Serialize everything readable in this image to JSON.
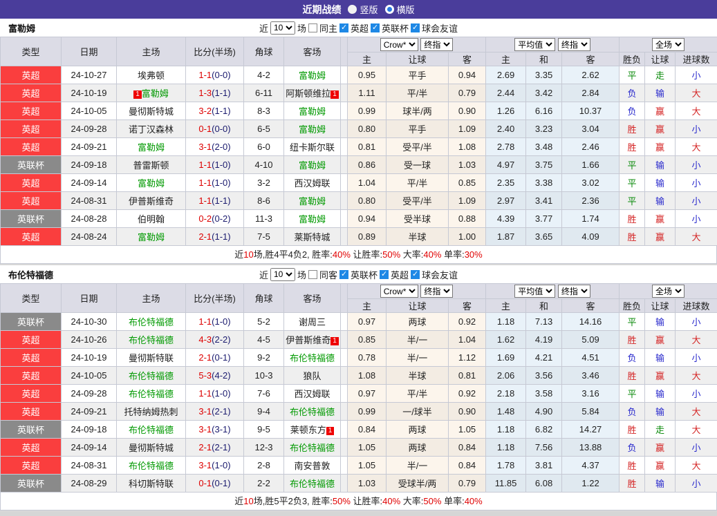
{
  "colors": {
    "titlebar_bg": "#4a3d9b",
    "epl_red": "#fa3e3e",
    "cup_gray": "#8a8a8a",
    "team_green": "#009900",
    "score_red": "#dd0000",
    "half_navy": "#1a1a6e",
    "win_red": "#d42424",
    "draw_green": "#0a8a0a",
    "lose_blue": "#2828cc",
    "avg_col_bg": "#e9f2f9",
    "handicap_col_bg": "#fcf5ec",
    "header_bg": "#dcdce6"
  },
  "title_bar": {
    "title": "近期战绩",
    "radios": [
      {
        "label": "竖版",
        "selected": false
      },
      {
        "label": "横版",
        "selected": true
      }
    ]
  },
  "sections": [
    {
      "team": "富勒姆",
      "filter": {
        "near_label": "近",
        "count": "10",
        "games_label": "场",
        "checkboxes": [
          {
            "label": "同主",
            "checked": false
          },
          {
            "label": "英超",
            "checked": true
          },
          {
            "label": "英联杯",
            "checked": true
          },
          {
            "label": "球会友谊",
            "checked": true
          }
        ]
      },
      "header": {
        "type": "类型",
        "date": "日期",
        "home": "主场",
        "score": "比分(半场)",
        "corners": "角球",
        "away": "客场",
        "odds_source": "Crow*",
        "odds_mode": "终指",
        "avg_source": "平均值",
        "avg_mode": "终指",
        "scope": "全场",
        "sub": [
          "主",
          "让球",
          "客",
          "主",
          "和",
          "客",
          "胜负",
          "让球",
          "进球数"
        ]
      },
      "rows": [
        {
          "league": "英超",
          "cup": false,
          "date": "24-10-27",
          "home": "埃弗顿",
          "homeGreen": false,
          "homeBadge": "",
          "score": "1-1",
          "half": "(0-0)",
          "corners": "4-2",
          "away": "富勒姆",
          "awayGreen": true,
          "awayBadge": "",
          "oddsHome": "0.95",
          "line": "平手",
          "oddsAway": "0.94",
          "avgHome": "2.69",
          "avgDraw": "3.35",
          "avgAway": "2.62",
          "res": "平",
          "hRes": "走",
          "gRes": "小"
        },
        {
          "league": "英超",
          "cup": false,
          "date": "24-10-19",
          "home": "富勒姆",
          "homeGreen": true,
          "homeBadge": "1",
          "score": "1-3",
          "half": "(1-1)",
          "corners": "6-11",
          "away": "阿斯顿维拉",
          "awayGreen": false,
          "awayBadge": "1",
          "oddsHome": "1.11",
          "line": "平/半",
          "oddsAway": "0.79",
          "avgHome": "2.44",
          "avgDraw": "3.42",
          "avgAway": "2.84",
          "res": "负",
          "hRes": "输",
          "gRes": "大"
        },
        {
          "league": "英超",
          "cup": false,
          "date": "24-10-05",
          "home": "曼彻斯特城",
          "homeGreen": false,
          "homeBadge": "",
          "score": "3-2",
          "half": "(1-1)",
          "corners": "8-3",
          "away": "富勒姆",
          "awayGreen": true,
          "awayBadge": "",
          "oddsHome": "0.99",
          "line": "球半/两",
          "oddsAway": "0.90",
          "avgHome": "1.26",
          "avgDraw": "6.16",
          "avgAway": "10.37",
          "res": "负",
          "hRes": "赢",
          "gRes": "大"
        },
        {
          "league": "英超",
          "cup": false,
          "date": "24-09-28",
          "home": "诺丁汉森林",
          "homeGreen": false,
          "homeBadge": "",
          "score": "0-1",
          "half": "(0-0)",
          "corners": "6-5",
          "away": "富勒姆",
          "awayGreen": true,
          "awayBadge": "",
          "oddsHome": "0.80",
          "line": "平手",
          "oddsAway": "1.09",
          "avgHome": "2.40",
          "avgDraw": "3.23",
          "avgAway": "3.04",
          "res": "胜",
          "hRes": "赢",
          "gRes": "小"
        },
        {
          "league": "英超",
          "cup": false,
          "date": "24-09-21",
          "home": "富勒姆",
          "homeGreen": true,
          "homeBadge": "",
          "score": "3-1",
          "half": "(2-0)",
          "corners": "6-0",
          "away": "纽卡斯尔联",
          "awayGreen": false,
          "awayBadge": "",
          "oddsHome": "0.81",
          "line": "受平/半",
          "oddsAway": "1.08",
          "avgHome": "2.78",
          "avgDraw": "3.48",
          "avgAway": "2.46",
          "res": "胜",
          "hRes": "赢",
          "gRes": "大"
        },
        {
          "league": "英联杯",
          "cup": true,
          "date": "24-09-18",
          "home": "普雷斯顿",
          "homeGreen": false,
          "homeBadge": "",
          "score": "1-1",
          "half": "(1-0)",
          "corners": "4-10",
          "away": "富勒姆",
          "awayGreen": true,
          "awayBadge": "",
          "oddsHome": "0.86",
          "line": "受一球",
          "oddsAway": "1.03",
          "avgHome": "4.97",
          "avgDraw": "3.75",
          "avgAway": "1.66",
          "res": "平",
          "hRes": "输",
          "gRes": "小"
        },
        {
          "league": "英超",
          "cup": false,
          "date": "24-09-14",
          "home": "富勒姆",
          "homeGreen": true,
          "homeBadge": "",
          "score": "1-1",
          "half": "(1-0)",
          "corners": "3-2",
          "away": "西汉姆联",
          "awayGreen": false,
          "awayBadge": "",
          "oddsHome": "1.04",
          "line": "平/半",
          "oddsAway": "0.85",
          "avgHome": "2.35",
          "avgDraw": "3.38",
          "avgAway": "3.02",
          "res": "平",
          "hRes": "输",
          "gRes": "小"
        },
        {
          "league": "英超",
          "cup": false,
          "date": "24-08-31",
          "home": "伊普斯维奇",
          "homeGreen": false,
          "homeBadge": "",
          "score": "1-1",
          "half": "(1-1)",
          "corners": "8-6",
          "away": "富勒姆",
          "awayGreen": true,
          "awayBadge": "",
          "oddsHome": "0.80",
          "line": "受平/半",
          "oddsAway": "1.09",
          "avgHome": "2.97",
          "avgDraw": "3.41",
          "avgAway": "2.36",
          "res": "平",
          "hRes": "输",
          "gRes": "小"
        },
        {
          "league": "英联杯",
          "cup": true,
          "date": "24-08-28",
          "home": "伯明翰",
          "homeGreen": false,
          "homeBadge": "",
          "score": "0-2",
          "half": "(0-2)",
          "corners": "11-3",
          "away": "富勒姆",
          "awayGreen": true,
          "awayBadge": "",
          "oddsHome": "0.94",
          "line": "受半球",
          "oddsAway": "0.88",
          "avgHome": "4.39",
          "avgDraw": "3.77",
          "avgAway": "1.74",
          "res": "胜",
          "hRes": "赢",
          "gRes": "小"
        },
        {
          "league": "英超",
          "cup": false,
          "date": "24-08-24",
          "home": "富勒姆",
          "homeGreen": true,
          "homeBadge": "",
          "score": "2-1",
          "half": "(1-1)",
          "corners": "7-5",
          "away": "莱斯特城",
          "awayGreen": false,
          "awayBadge": "",
          "oddsHome": "0.89",
          "line": "半球",
          "oddsAway": "1.00",
          "avgHome": "1.87",
          "avgDraw": "3.65",
          "avgAway": "4.09",
          "res": "胜",
          "hRes": "赢",
          "gRes": "大"
        }
      ],
      "summary": [
        {
          "t": "近",
          "r": false
        },
        {
          "t": "10",
          "r": true
        },
        {
          "t": "场,胜4平4负2, 胜率:",
          "r": false
        },
        {
          "t": "40%",
          "r": true
        },
        {
          "t": " 让胜率:",
          "r": false
        },
        {
          "t": "50%",
          "r": true
        },
        {
          "t": " 大率:",
          "r": false
        },
        {
          "t": "40%",
          "r": true
        },
        {
          "t": " 单率:",
          "r": false
        },
        {
          "t": "30%",
          "r": true
        }
      ]
    },
    {
      "team": "布伦特福德",
      "filter": {
        "near_label": "近",
        "count": "10",
        "games_label": "场",
        "checkboxes": [
          {
            "label": "同客",
            "checked": false
          },
          {
            "label": "英联杯",
            "checked": true
          },
          {
            "label": "英超",
            "checked": true
          },
          {
            "label": "球会友谊",
            "checked": true
          }
        ]
      },
      "header": {
        "type": "类型",
        "date": "日期",
        "home": "主场",
        "score": "比分(半场)",
        "corners": "角球",
        "away": "客场",
        "odds_source": "Crow*",
        "odds_mode": "终指",
        "avg_source": "平均值",
        "avg_mode": "终指",
        "scope": "全场",
        "sub": [
          "主",
          "让球",
          "客",
          "主",
          "和",
          "客",
          "胜负",
          "让球",
          "进球数"
        ]
      },
      "rows": [
        {
          "league": "英联杯",
          "cup": true,
          "date": "24-10-30",
          "home": "布伦特福德",
          "homeGreen": true,
          "homeBadge": "",
          "score": "1-1",
          "half": "(1-0)",
          "corners": "5-2",
          "away": "谢周三",
          "awayGreen": false,
          "awayBadge": "",
          "oddsHome": "0.97",
          "line": "两球",
          "oddsAway": "0.92",
          "avgHome": "1.18",
          "avgDraw": "7.13",
          "avgAway": "14.16",
          "res": "平",
          "hRes": "输",
          "gRes": "小"
        },
        {
          "league": "英超",
          "cup": false,
          "date": "24-10-26",
          "home": "布伦特福德",
          "homeGreen": true,
          "homeBadge": "",
          "score": "4-3",
          "half": "(2-2)",
          "corners": "4-5",
          "away": "伊普斯维奇",
          "awayGreen": false,
          "awayBadge": "1",
          "oddsHome": "0.85",
          "line": "半/一",
          "oddsAway": "1.04",
          "avgHome": "1.62",
          "avgDraw": "4.19",
          "avgAway": "5.09",
          "res": "胜",
          "hRes": "赢",
          "gRes": "大"
        },
        {
          "league": "英超",
          "cup": false,
          "date": "24-10-19",
          "home": "曼彻斯特联",
          "homeGreen": false,
          "homeBadge": "",
          "score": "2-1",
          "half": "(0-1)",
          "corners": "9-2",
          "away": "布伦特福德",
          "awayGreen": true,
          "awayBadge": "",
          "oddsHome": "0.78",
          "line": "半/一",
          "oddsAway": "1.12",
          "avgHome": "1.69",
          "avgDraw": "4.21",
          "avgAway": "4.51",
          "res": "负",
          "hRes": "输",
          "gRes": "小"
        },
        {
          "league": "英超",
          "cup": false,
          "date": "24-10-05",
          "home": "布伦特福德",
          "homeGreen": true,
          "homeBadge": "",
          "score": "5-3",
          "half": "(4-2)",
          "corners": "10-3",
          "away": "狼队",
          "awayGreen": false,
          "awayBadge": "",
          "oddsHome": "1.08",
          "line": "半球",
          "oddsAway": "0.81",
          "avgHome": "2.06",
          "avgDraw": "3.56",
          "avgAway": "3.46",
          "res": "胜",
          "hRes": "赢",
          "gRes": "大"
        },
        {
          "league": "英超",
          "cup": false,
          "date": "24-09-28",
          "home": "布伦特福德",
          "homeGreen": true,
          "homeBadge": "",
          "score": "1-1",
          "half": "(1-0)",
          "corners": "7-6",
          "away": "西汉姆联",
          "awayGreen": false,
          "awayBadge": "",
          "oddsHome": "0.97",
          "line": "平/半",
          "oddsAway": "0.92",
          "avgHome": "2.18",
          "avgDraw": "3.58",
          "avgAway": "3.16",
          "res": "平",
          "hRes": "输",
          "gRes": "小"
        },
        {
          "league": "英超",
          "cup": false,
          "date": "24-09-21",
          "home": "托特纳姆热刺",
          "homeGreen": false,
          "homeBadge": "",
          "score": "3-1",
          "half": "(2-1)",
          "corners": "9-4",
          "away": "布伦特福德",
          "awayGreen": true,
          "awayBadge": "",
          "oddsHome": "0.99",
          "line": "一/球半",
          "oddsAway": "0.90",
          "avgHome": "1.48",
          "avgDraw": "4.90",
          "avgAway": "5.84",
          "res": "负",
          "hRes": "输",
          "gRes": "大"
        },
        {
          "league": "英联杯",
          "cup": true,
          "date": "24-09-18",
          "home": "布伦特福德",
          "homeGreen": true,
          "homeBadge": "",
          "score": "3-1",
          "half": "(3-1)",
          "corners": "9-5",
          "away": "莱顿东方",
          "awayGreen": false,
          "awayBadge": "1",
          "oddsHome": "0.84",
          "line": "两球",
          "oddsAway": "1.05",
          "avgHome": "1.18",
          "avgDraw": "6.82",
          "avgAway": "14.27",
          "res": "胜",
          "hRes": "走",
          "gRes": "大"
        },
        {
          "league": "英超",
          "cup": false,
          "date": "24-09-14",
          "home": "曼彻斯特城",
          "homeGreen": false,
          "homeBadge": "",
          "score": "2-1",
          "half": "(2-1)",
          "corners": "12-3",
          "away": "布伦特福德",
          "awayGreen": true,
          "awayBadge": "",
          "oddsHome": "1.05",
          "line": "两球",
          "oddsAway": "0.84",
          "avgHome": "1.18",
          "avgDraw": "7.56",
          "avgAway": "13.88",
          "res": "负",
          "hRes": "赢",
          "gRes": "小"
        },
        {
          "league": "英超",
          "cup": false,
          "date": "24-08-31",
          "home": "布伦特福德",
          "homeGreen": true,
          "homeBadge": "",
          "score": "3-1",
          "half": "(1-0)",
          "corners": "2-8",
          "away": "南安普敦",
          "awayGreen": false,
          "awayBadge": "",
          "oddsHome": "1.05",
          "line": "半/一",
          "oddsAway": "0.84",
          "avgHome": "1.78",
          "avgDraw": "3.81",
          "avgAway": "4.37",
          "res": "胜",
          "hRes": "赢",
          "gRes": "大"
        },
        {
          "league": "英联杯",
          "cup": true,
          "date": "24-08-29",
          "home": "科切斯特联",
          "homeGreen": false,
          "homeBadge": "",
          "score": "0-1",
          "half": "(0-1)",
          "corners": "2-2",
          "away": "布伦特福德",
          "awayGreen": true,
          "awayBadge": "",
          "oddsHome": "1.03",
          "line": "受球半/两",
          "oddsAway": "0.79",
          "avgHome": "11.85",
          "avgDraw": "6.08",
          "avgAway": "1.22",
          "res": "胜",
          "hRes": "输",
          "gRes": "小"
        }
      ],
      "summary": [
        {
          "t": "近",
          "r": false
        },
        {
          "t": "10",
          "r": true
        },
        {
          "t": "场,胜5平2负3, 胜率:",
          "r": false
        },
        {
          "t": "50%",
          "r": true
        },
        {
          "t": " 让胜率:",
          "r": false
        },
        {
          "t": "40%",
          "r": true
        },
        {
          "t": " 大率:",
          "r": false
        },
        {
          "t": "50%",
          "r": true
        },
        {
          "t": " 单率:",
          "r": false
        },
        {
          "t": "40%",
          "r": true
        }
      ]
    }
  ]
}
